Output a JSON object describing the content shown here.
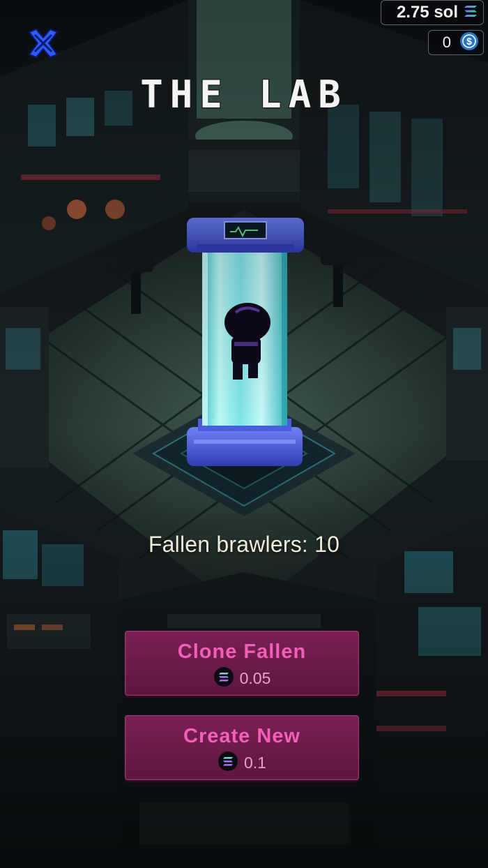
{
  "header": {
    "title": "THE LAB"
  },
  "balances": {
    "sol": {
      "value": "2.75 sol",
      "icon": "solana-icon"
    },
    "usdc": {
      "value": "0",
      "icon": "usdc-icon"
    }
  },
  "status": {
    "fallen_text": "Fallen brawlers: 10"
  },
  "actions": {
    "clone": {
      "label": "Clone Fallen",
      "cost": "0.05",
      "icon": "solana-icon"
    },
    "create": {
      "label": "Create New",
      "cost": "0.1",
      "icon": "solana-icon"
    }
  },
  "colors": {
    "accent_blue": "#2e5bff",
    "button_bg": "#6b1b4a",
    "button_text": "#f25fb8",
    "tube_glass": "#8ef0f2",
    "tube_frame": "#4a5de0"
  }
}
